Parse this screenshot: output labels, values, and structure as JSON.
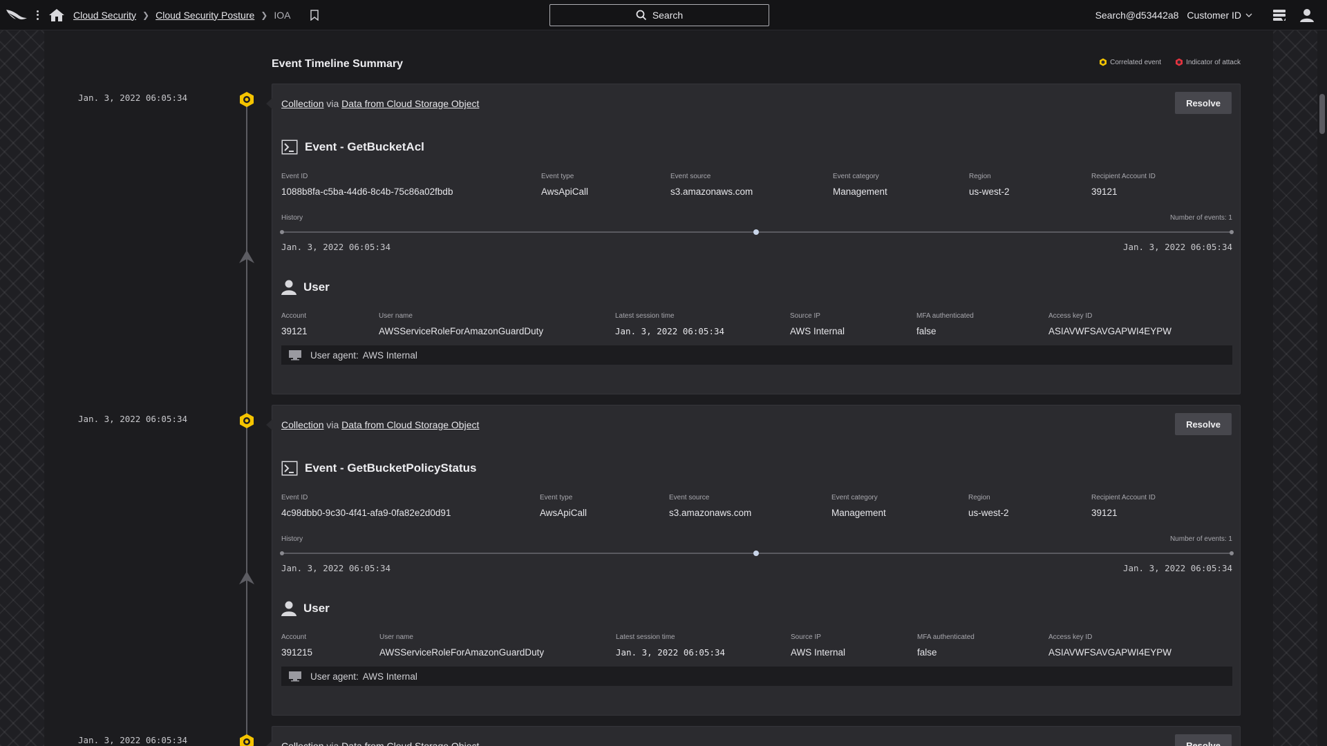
{
  "nav": {
    "breadcrumbs": [
      "Cloud Security",
      "Cloud Security Posture"
    ],
    "current": "IOA",
    "search_label": "Search",
    "user_handle": "Search@d53442a8",
    "customer_label": "Customer ID"
  },
  "page": {
    "title": "Event Timeline Summary",
    "legend_correlated": "Correlated event",
    "legend_ioa": "Indicator of attack"
  },
  "colors": {
    "correlated": "#f5c400",
    "ioa": "#e5333f",
    "background": "#1c1c1f",
    "card": "#2b2b2f"
  },
  "labels": {
    "resolve": "Resolve",
    "via": "via",
    "event_id": "Event ID",
    "event_type": "Event type",
    "event_source": "Event source",
    "event_category": "Event category",
    "region": "Region",
    "recipient_account_id": "Recipient Account ID",
    "history": "History",
    "user": "User",
    "account": "Account",
    "user_name": "User name",
    "latest_session_time": "Latest session time",
    "source_ip": "Source IP",
    "mfa_authenticated": "MFA authenticated",
    "access_key_id": "Access key ID",
    "user_agent": "User agent:"
  },
  "events": [
    {
      "timestamp": "Jan. 3, 2022 06:05:34",
      "tactic": "Collection",
      "technique": "Data from Cloud Storage Object",
      "title": "Event - GetBucketAcl",
      "event_id": "1088b8fa-c5ba-44d6-8c4b-75c86a02fbdb",
      "event_type": "AwsApiCall",
      "event_source": "s3.amazonaws.com",
      "event_category": "Management",
      "region": "us-west-2",
      "recipient_account_id": "39121",
      "history_count": "Number of events: 1",
      "history_start": "Jan. 3, 2022 06:05:34",
      "history_end": "Jan. 3, 2022 06:05:34",
      "account": "39121",
      "user_name": "AWSServiceRoleForAmazonGuardDuty",
      "latest_session_time": "Jan. 3, 2022 06:05:34",
      "source_ip": "AWS Internal",
      "mfa_authenticated": "false",
      "access_key_id": "ASIAVWFSAVGAPWI4EYPW",
      "user_agent": "AWS Internal"
    },
    {
      "timestamp": "Jan. 3, 2022 06:05:34",
      "tactic": "Collection",
      "technique": "Data from Cloud Storage Object",
      "title": "Event - GetBucketPolicyStatus",
      "event_id": "4c98dbb0-9c30-4f41-afa9-0fa82e2d0d91",
      "event_type": "AwsApiCall",
      "event_source": "s3.amazonaws.com",
      "event_category": "Management",
      "region": "us-west-2",
      "recipient_account_id": "39121",
      "history_count": "Number of events: 1",
      "history_start": "Jan. 3, 2022 06:05:34",
      "history_end": "Jan. 3, 2022 06:05:34",
      "account": "391215",
      "user_name": "AWSServiceRoleForAmazonGuardDuty",
      "latest_session_time": "Jan. 3, 2022 06:05:34",
      "source_ip": "AWS Internal",
      "mfa_authenticated": "false",
      "access_key_id": "ASIAVWFSAVGAPWI4EYPW",
      "user_agent": "AWS Internal"
    },
    {
      "timestamp": "Jan. 3, 2022 06:05:34",
      "tactic": "Collection",
      "technique": "Data from Cloud Storage Object"
    }
  ]
}
